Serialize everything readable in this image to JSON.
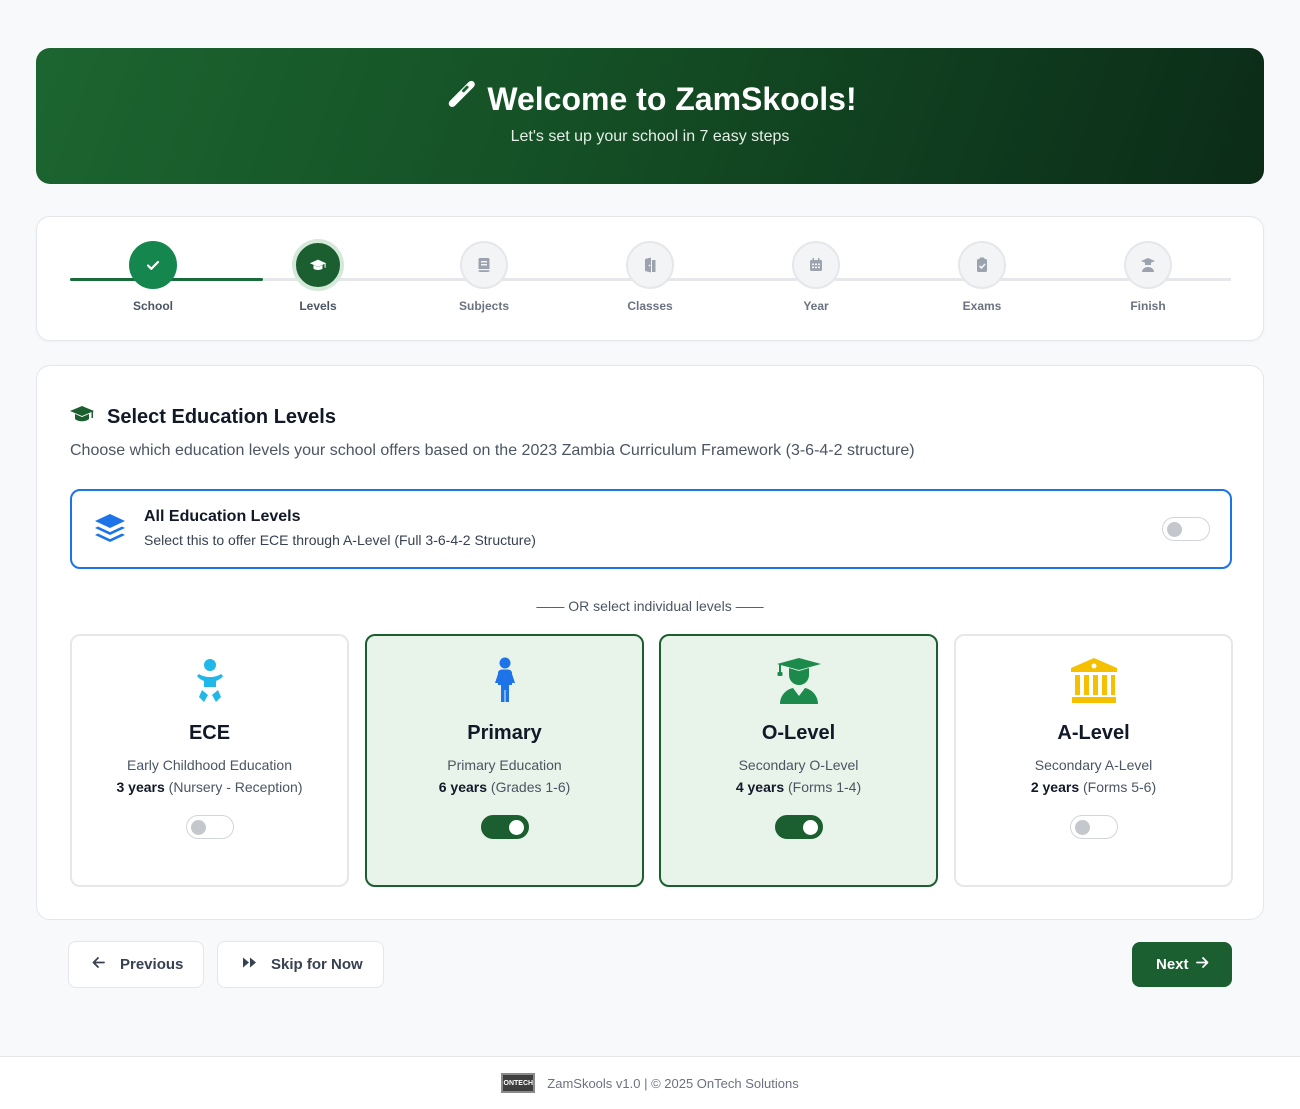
{
  "hero": {
    "title": "Welcome to ZamSkools!",
    "subtitle": "Let's set up your school in 7 easy steps"
  },
  "steps": [
    {
      "label": "School",
      "icon": "check-icon",
      "state": "done"
    },
    {
      "label": "Levels",
      "icon": "graduation-cap-icon",
      "state": "active"
    },
    {
      "label": "Subjects",
      "icon": "book-icon",
      "state": "pending"
    },
    {
      "label": "Classes",
      "icon": "door-icon",
      "state": "pending"
    },
    {
      "label": "Year",
      "icon": "calendar-icon",
      "state": "pending"
    },
    {
      "label": "Exams",
      "icon": "clipboard-check-icon",
      "state": "pending"
    },
    {
      "label": "Finish",
      "icon": "graduate-icon",
      "state": "pending"
    }
  ],
  "section": {
    "title": "Select Education Levels",
    "description": "Choose which education levels your school offers based on the 2023 Zambia Curriculum Framework (3-6-4-2 structure)"
  },
  "all_levels": {
    "title": "All Education Levels",
    "subtitle": "Select this to offer ECE through A-Level (Full 3-6-4-2 Structure)",
    "enabled": false
  },
  "or_text": "—— OR select individual levels ——",
  "levels": [
    {
      "name": "ECE",
      "description": "Early Childhood Education",
      "years": "3 years",
      "detail": "(Nursery - Reception)",
      "enabled": false,
      "icon": "baby-icon",
      "color": "#1fb8e8"
    },
    {
      "name": "Primary",
      "description": "Primary Education",
      "years": "6 years",
      "detail": "(Grades 1-6)",
      "enabled": true,
      "icon": "child-icon",
      "color": "#1d74e8"
    },
    {
      "name": "O-Level",
      "description": "Secondary O-Level",
      "years": "4 years",
      "detail": "(Forms 1-4)",
      "enabled": true,
      "icon": "graduate-icon",
      "color": "#1b8a4a"
    },
    {
      "name": "A-Level",
      "description": "Secondary A-Level",
      "years": "2 years",
      "detail": "(Forms 5-6)",
      "enabled": false,
      "icon": "institution-icon",
      "color": "#f5c000"
    }
  ],
  "buttons": {
    "previous": "Previous",
    "skip": "Skip for Now",
    "next": "Next"
  },
  "footer": {
    "logo_text": "ONTECH",
    "text": "ZamSkools v1.0 | © 2025 OnTech Solutions"
  },
  "colors": {
    "brand_green": "#1b5e2f",
    "selection_blue": "#1d74e8"
  }
}
